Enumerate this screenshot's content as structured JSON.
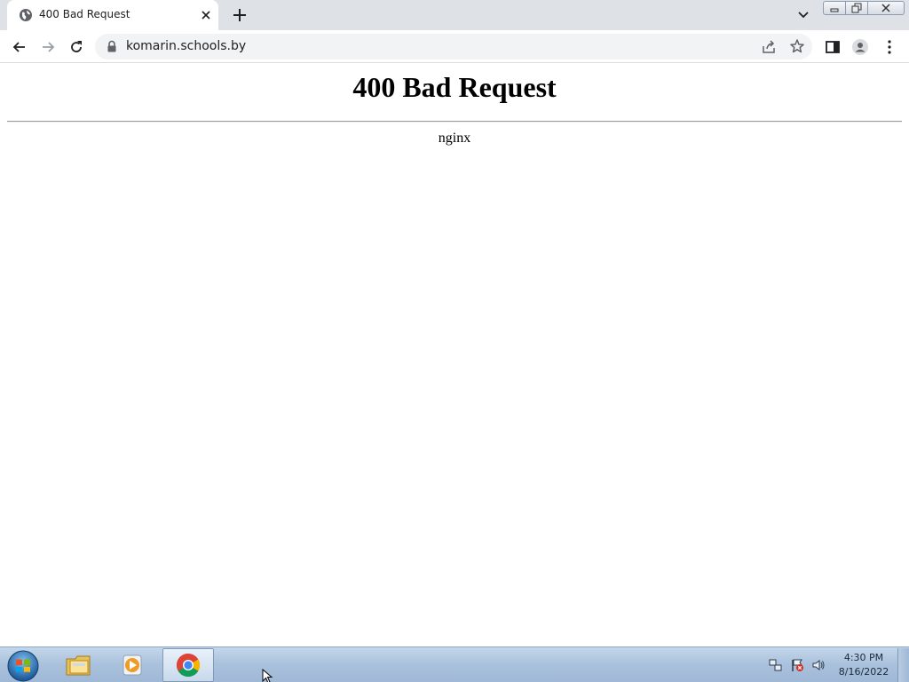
{
  "browser": {
    "tab": {
      "title": "400 Bad Request",
      "favicon": "globe-icon"
    },
    "new_tab_icon": "plus-icon",
    "tab_search_icon": "chevron-down-icon",
    "window_controls": [
      "minimize-icon",
      "maximize-icon",
      "close-icon"
    ],
    "toolbar": {
      "back_icon": "arrow-left-icon",
      "forward_icon": "arrow-right-icon",
      "reload_icon": "reload-icon",
      "security_icon": "lock-icon",
      "url": "komarin.schools.by",
      "share_icon": "share-icon",
      "bookmark_icon": "star-icon",
      "side_panel_icon": "side-panel-icon",
      "profile_icon": "profile-icon",
      "menu_icon": "kebab-menu-icon"
    }
  },
  "page": {
    "heading": "400 Bad Request",
    "server": "nginx"
  },
  "taskbar": {
    "start_icon": "windows-start-icon",
    "apps": [
      {
        "name": "file-explorer-icon",
        "active": false
      },
      {
        "name": "media-player-icon",
        "active": false
      },
      {
        "name": "chrome-icon",
        "active": true
      }
    ],
    "tray": [
      "network-icon",
      "action-center-flag-icon",
      "volume-icon"
    ],
    "time": "4:30 PM",
    "date": "8/16/2022"
  },
  "colors": {
    "tabstrip_bg": "#dee1e6",
    "omnibox_bg": "#f1f3f4",
    "taskbar_bg": "#a9c1dc"
  }
}
